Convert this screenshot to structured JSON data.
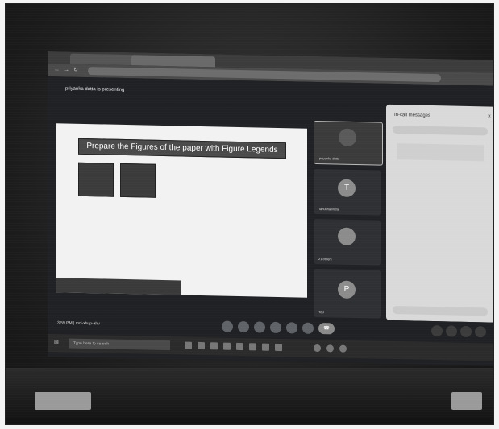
{
  "browser": {
    "tab_1": "",
    "tab_2": "",
    "url": ""
  },
  "meeting": {
    "presenting_label": "priyanka dutta is presenting",
    "clock": "3:59 PM",
    "meeting_code": "mci-xhup-ahv"
  },
  "slide": {
    "title": "Prepare the Figures of the paper with Figure Legends",
    "caption": ""
  },
  "tiles": [
    {
      "initial": "",
      "name": "priyanka dutta"
    },
    {
      "initial": "T",
      "name": "Tanusha Mitra"
    },
    {
      "initial": "",
      "name": "21 others"
    },
    {
      "initial": "P",
      "name": "You"
    }
  ],
  "chat": {
    "title": "In-call messages",
    "close": "×"
  },
  "controls": {
    "end_glyph": "☎"
  },
  "taskbar": {
    "search_placeholder": "Type here to search"
  }
}
